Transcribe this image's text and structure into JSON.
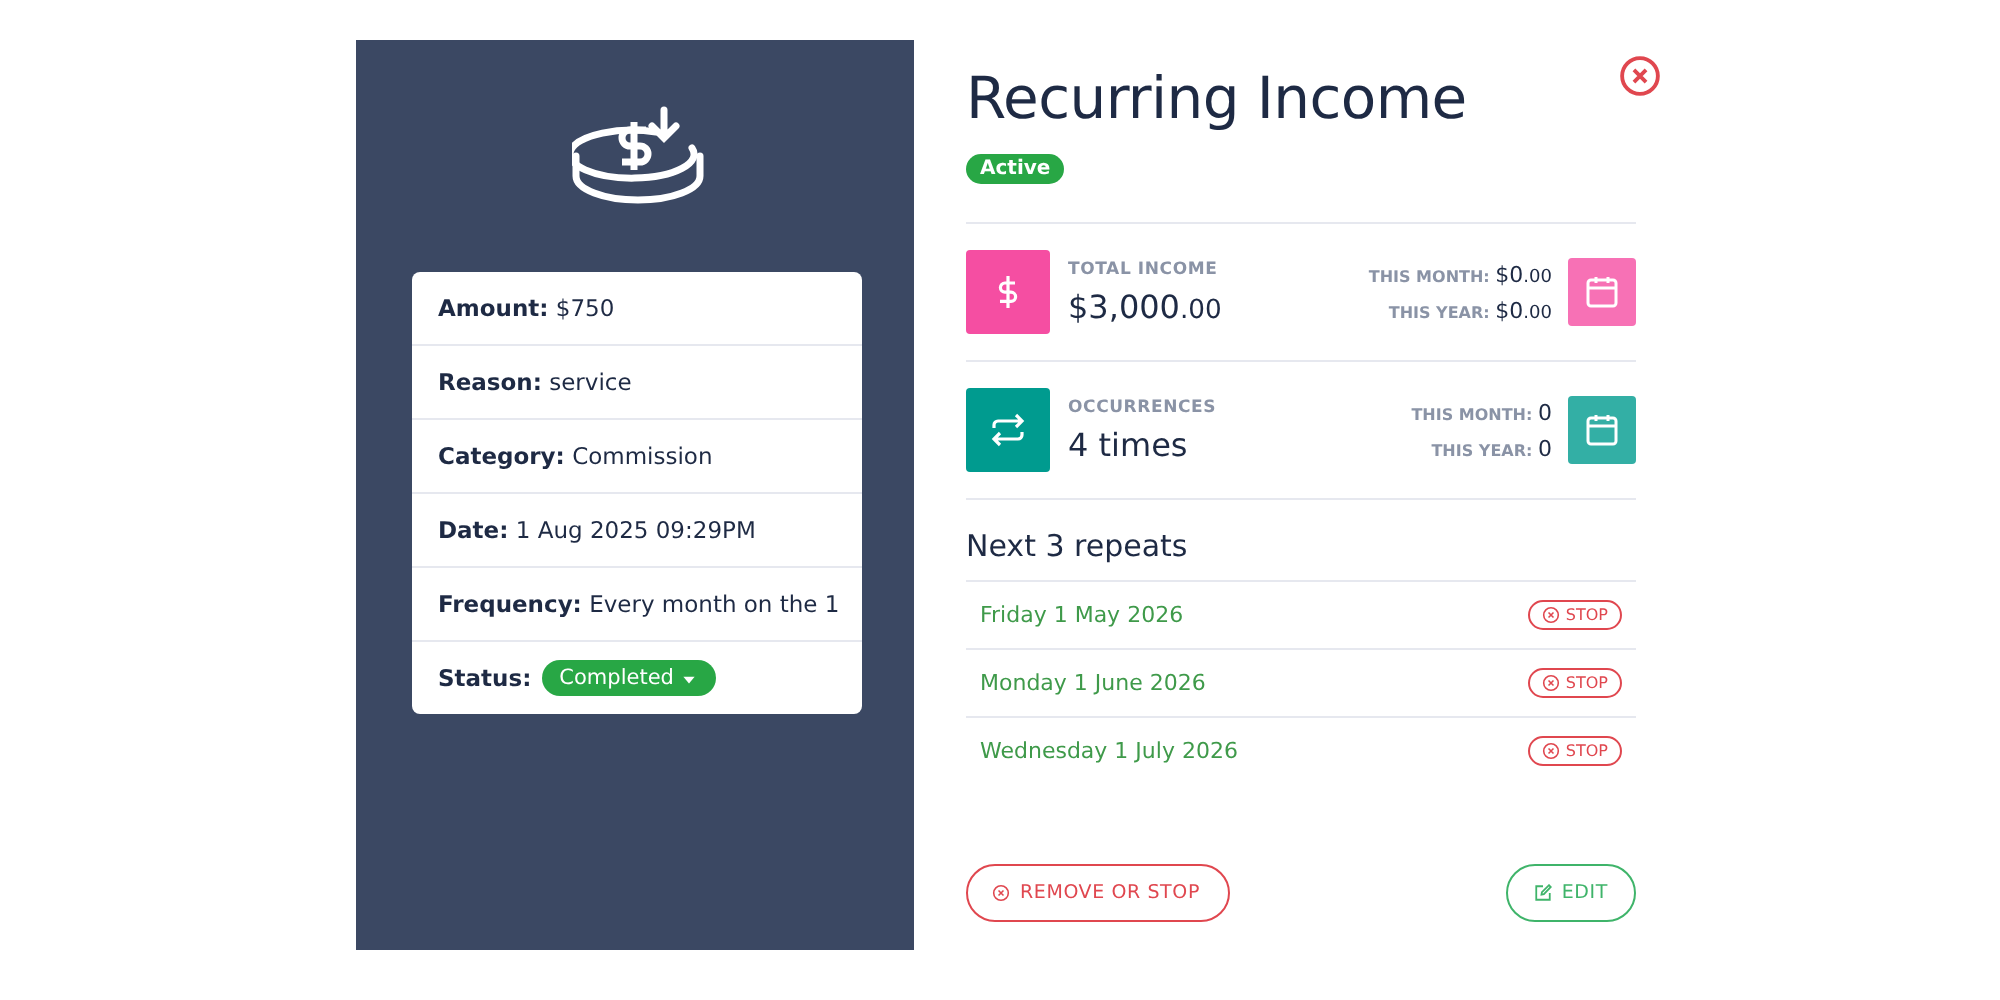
{
  "details": [
    {
      "label": "Amount:",
      "value": "$750"
    },
    {
      "label": "Reason:",
      "value": "service"
    },
    {
      "label": "Category:",
      "value": "Commission"
    },
    {
      "label": "Date:",
      "value": "1 Aug 2025 09:29PM"
    },
    {
      "label": "Frequency:",
      "value": "Every month on the 1"
    }
  ],
  "status": {
    "label": "Status:",
    "value": "Completed"
  },
  "title": "Recurring Income",
  "badge": "Active",
  "stats": [
    {
      "kind": "money",
      "color": "#f54ea2",
      "label": "TOTAL INCOME",
      "value": "$3,000",
      "value_small": ".00",
      "month_label": "THIS MONTH:",
      "month_value": "$0",
      "month_small": ".00",
      "year_label": "THIS YEAR:",
      "year_value": "$0",
      "year_small": ".00"
    },
    {
      "kind": "count",
      "color": "#009b8f",
      "label": "OCCURRENCES",
      "value": "4 times",
      "month_label": "THIS MONTH:",
      "month_value": "0",
      "year_label": "THIS YEAR:",
      "year_value": "0"
    }
  ],
  "repeats_title": "Next 3 repeats",
  "repeats": [
    {
      "date": "Friday 1 May 2026",
      "action": "STOP"
    },
    {
      "date": "Monday 1 June 2026",
      "action": "STOP"
    },
    {
      "date": "Wednesday 1 July 2026",
      "action": "STOP"
    }
  ],
  "buttons": {
    "remove": "REMOVE OR STOP",
    "edit": "EDIT"
  }
}
